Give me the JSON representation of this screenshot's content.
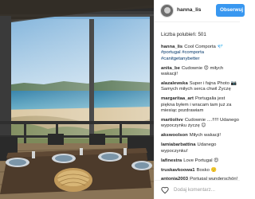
{
  "photo": {
    "alt": ""
  },
  "header": {
    "username": "hanna_lis",
    "follow_label": "Obserwuj"
  },
  "likes_text": "Liczba polubień: 501",
  "comments": [
    {
      "user": "hanna_lis",
      "text": "Cool Comporta 💎 ",
      "tags": "#portugal #comporta #canitgetanybetter"
    },
    {
      "user": "anita_be",
      "text": "Cudownie 😍 miłych wakacji!",
      "tags": ""
    },
    {
      "user": "alazalewska",
      "text": "Super i fajna Photo 📷 Samych miłych serca chwil Życzę",
      "tags": ""
    },
    {
      "user": "margaritaa_art",
      "text": "Portugalia jest piękna byłem i wracam tam już za miesiąc pozdrawiam",
      "tags": ""
    },
    {
      "user": "martiolivv",
      "text": "Cudownie ....!!!!! Udanego wypoczynku życzę 😊",
      "tags": ""
    },
    {
      "user": "akswoolson",
      "text": "Miłych wakacji!",
      "tags": ""
    },
    {
      "user": "lamiabarbattina",
      "text": "Udanego wypoczynku!",
      "tags": ""
    },
    {
      "user": "lafinestra",
      "text": "Love Portugal 😍",
      "tags": ""
    },
    {
      "user": "truskavkoowa1",
      "text": "Bosko 🙂",
      "tags": ""
    },
    {
      "user": "antonia2003",
      "text": "Portugal wunderschön! Udanego Urlaub, zdrowka.",
      "tags": ""
    },
    {
      "user": "kasf1aa",
      "text": "Bajecznie 😍😍",
      "tags": ""
    }
  ],
  "footer": {
    "add_comment_placeholder": "Dodaj komentarz..."
  }
}
